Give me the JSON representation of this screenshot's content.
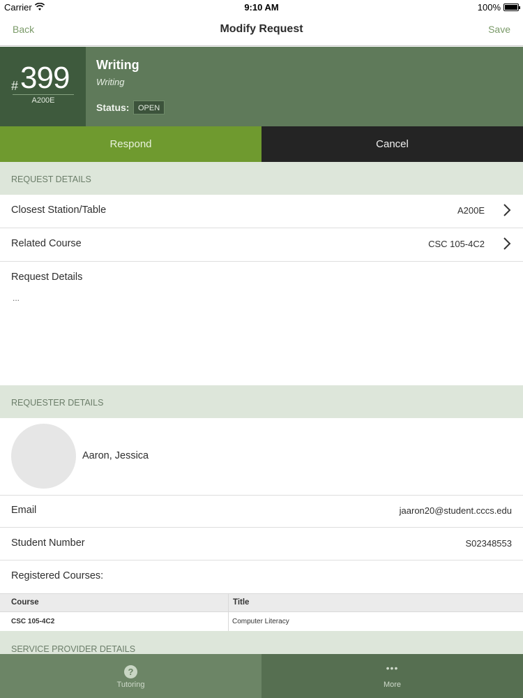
{
  "status_bar": {
    "carrier": "Carrier",
    "time": "9:10 AM",
    "battery": "100%"
  },
  "nav": {
    "back": "Back",
    "title": "Modify Request",
    "save": "Save"
  },
  "header": {
    "hash": "#",
    "number": "399",
    "station": "A200E",
    "type": "Writing",
    "subtype": "Writing",
    "status_label": "Status:",
    "status_value": "OPEN"
  },
  "actions": {
    "respond": "Respond",
    "cancel": "Cancel"
  },
  "request_details": {
    "section_title": "REQUEST DETAILS",
    "station_label": "Closest Station/Table",
    "station_value": "A200E",
    "course_label": "Related Course",
    "course_value": "CSC 105-4C2",
    "details_label": "Request Details",
    "details_text": "..."
  },
  "requester": {
    "section_title": "REQUESTER DETAILS",
    "name": "Aaron, Jessica",
    "email_label": "Email",
    "email_value": "jaaron20@student.cccs.edu",
    "student_number_label": "Student Number",
    "student_number_value": "S02348553",
    "courses_label": "Registered Courses:",
    "table": {
      "headers": [
        "Course",
        "Title"
      ],
      "rows": [
        [
          "CSC 105-4C2",
          "Computer Literacy"
        ]
      ]
    }
  },
  "service_provider": {
    "section_title": "SERVICE PROVIDER DETAILS"
  },
  "tabs": [
    {
      "label": "Tutoring",
      "icon": "question-icon"
    },
    {
      "label": "More",
      "icon": "more-dots-icon"
    }
  ],
  "colors": {
    "header_bg": "#5f7a5a",
    "id_box_bg": "#3e5a3d",
    "respond_bg": "#6f9a2f",
    "cancel_bg": "#242424",
    "section_bg": "#dde6da",
    "accent": "#7a9a68"
  }
}
